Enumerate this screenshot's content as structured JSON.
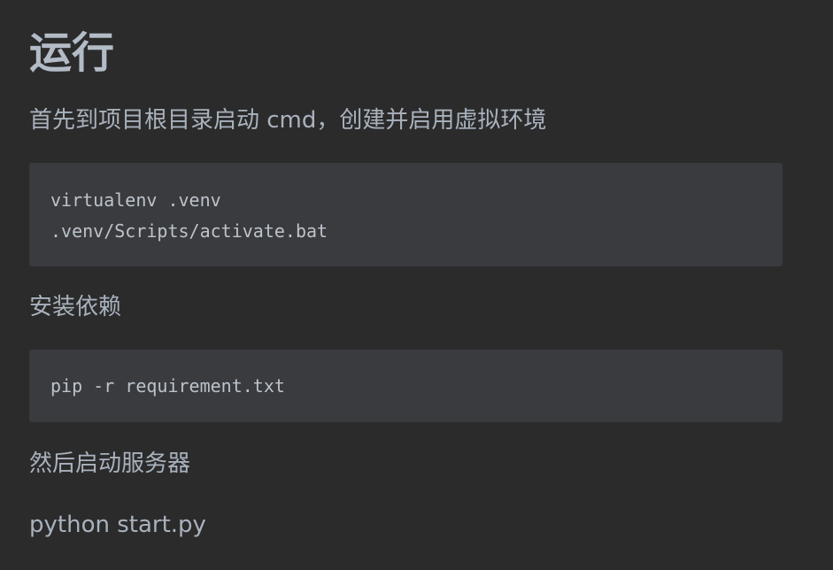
{
  "heading": "运行",
  "intro": "首先到项目根目录启动 cmd，创建并启用虚拟环境",
  "venv_code": [
    "virtualenv .venv",
    ".venv/Scripts/activate.bat"
  ],
  "install_label": "安装依赖",
  "install_code": [
    "pip -r requirement.txt"
  ],
  "start_label": "然后启动服务器",
  "start_command": "python start.py"
}
